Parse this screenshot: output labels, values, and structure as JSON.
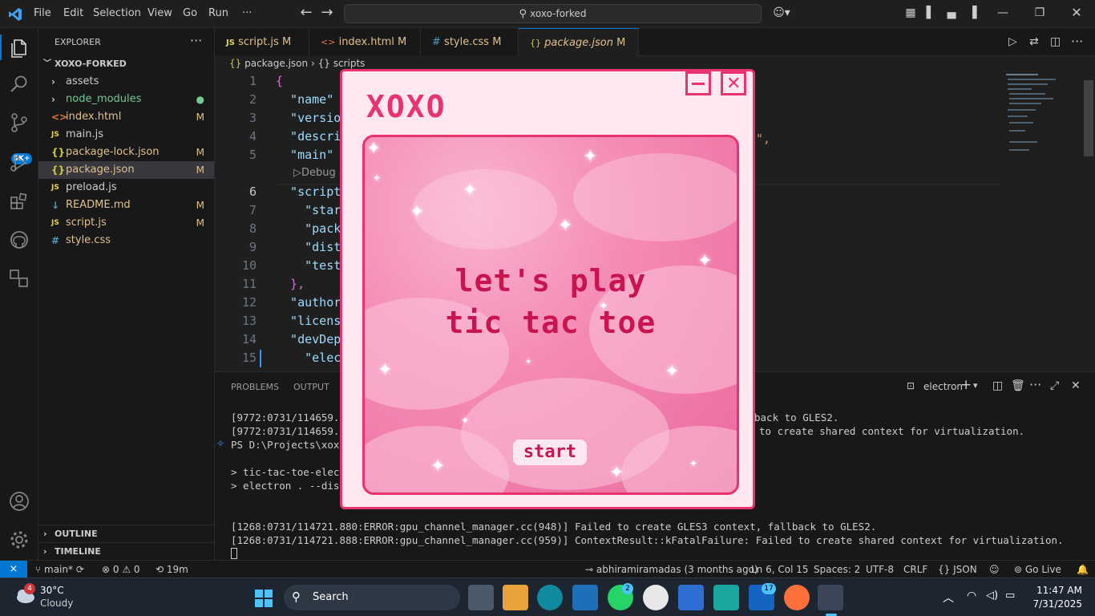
{
  "titlebar": {
    "menus": [
      "File",
      "Edit",
      "Selection",
      "View",
      "Go",
      "Run",
      "···"
    ],
    "search": "xoxo-forked"
  },
  "activity": {
    "badge": "5K+"
  },
  "explorer": {
    "header": "EXPLORER",
    "root": "XOXO-FORKED",
    "items": [
      {
        "label": "assets",
        "icon": "›",
        "status": "",
        "color": "#cccccc"
      },
      {
        "label": "node_modules",
        "icon": "›",
        "status": "●",
        "color": "#73c991"
      },
      {
        "label": "index.html",
        "icon": "<>",
        "status": "M",
        "color": "#e2c08d"
      },
      {
        "label": "main.js",
        "icon": "JS",
        "status": "",
        "color": "#cccccc"
      },
      {
        "label": "package-lock.json",
        "icon": "{}",
        "status": "M",
        "color": "#e2c08d"
      },
      {
        "label": "package.json",
        "icon": "{}",
        "status": "M",
        "color": "#e2c08d"
      },
      {
        "label": "preload.js",
        "icon": "JS",
        "status": "",
        "color": "#cccccc"
      },
      {
        "label": "README.md",
        "icon": "↓",
        "status": "M",
        "color": "#e2c08d"
      },
      {
        "label": "script.js",
        "icon": "JS",
        "status": "M",
        "color": "#e2c08d"
      },
      {
        "label": "style.css",
        "icon": "#",
        "status": "",
        "color": "#e2c08d"
      }
    ],
    "outline": "OUTLINE",
    "timeline": "TIMELINE"
  },
  "tabs": [
    {
      "label": "script.js",
      "icon": "JS",
      "status": "M"
    },
    {
      "label": "index.html",
      "icon": "<>",
      "status": "M"
    },
    {
      "label": "style.css",
      "icon": "#",
      "status": "M"
    },
    {
      "label": "package.json",
      "icon": "{}",
      "status": "M"
    }
  ],
  "breadcrumb": {
    "file": "package.json",
    "sep": "›",
    "symbol": "scripts"
  },
  "editor": {
    "lines": [
      {
        "n": "1",
        "code": "{"
      },
      {
        "n": "2",
        "code": "  \"name\""
      },
      {
        "n": "3",
        "code": "  \"versio"
      },
      {
        "n": "4",
        "code": "  \"descri"
      },
      {
        "n": "5",
        "code": "  \"main\""
      },
      {
        "n": "6",
        "code": "  \"script"
      },
      {
        "n": "7",
        "code": "    \"star"
      },
      {
        "n": "8",
        "code": "    \"pack"
      },
      {
        "n": "9",
        "code": "    \"dist"
      },
      {
        "n": "10",
        "code": "    \"test"
      },
      {
        "n": "11",
        "code": "  },"
      },
      {
        "n": "12",
        "code": "  \"author"
      },
      {
        "n": "13",
        "code": "  \"licens"
      },
      {
        "n": "14",
        "code": "  \"devDep"
      },
      {
        "n": "15",
        "code": "    \"elec"
      }
    ],
    "codelens": "▷Debug",
    "tail4": "\","
  },
  "panel": {
    "tabs": [
      "PROBLEMS",
      "OUTPUT"
    ],
    "terminal_name": "electron",
    "lines": [
      "[9772:0731/114659.46",
      "[9772:0731/114659.46",
      "PS D:\\Projects\\xoxo-",
      "> tic-tac-toe-electr",
      "> electron . --disab",
      "[1268:0731/114721.880:ERROR:gpu_channel_manager.cc(948)] Failed to create GLES3 context, fallback to GLES2.",
      "[1268:0731/114721.888:ERROR:gpu_channel_manager.cc(959)] ContextResult::kFatalFailure: Failed to create shared context for virtualization."
    ],
    "right1": "back to GLES2.",
    "right2": "to create shared context for virtualization."
  },
  "statusbar": {
    "branch": "main*",
    "errors": "0",
    "warnings": "0",
    "time": "19m",
    "author": "abhiramiramadas (3 months ago)",
    "position": "Ln 6, Col 15",
    "spaces": "Spaces: 2",
    "encoding": "UTF-8",
    "eol": "CRLF",
    "language": "JSON",
    "golive": "Go Live"
  },
  "popup": {
    "title": "XOXO",
    "line1": "let's play",
    "line2": "tic tac toe",
    "start": "start"
  },
  "taskbar": {
    "temp": "30°C",
    "weather": "Cloudy",
    "weather_badge": "4",
    "search": "Search",
    "whatsapp_badge": "2",
    "app_badge": "17",
    "time": "11:47 AM",
    "date": "7/31/2025"
  }
}
